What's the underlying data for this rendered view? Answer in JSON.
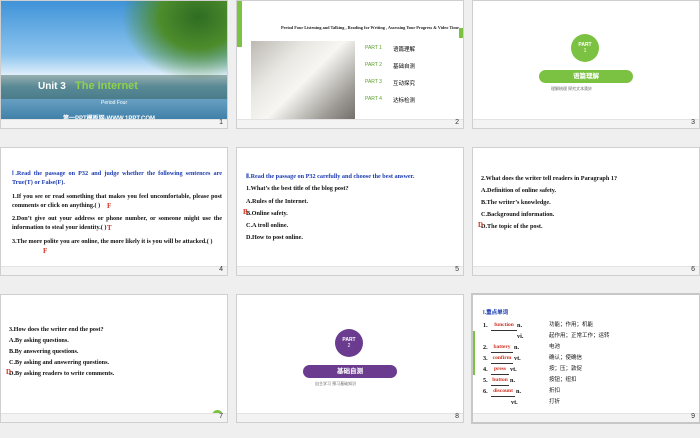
{
  "slides": [
    {
      "num": "1",
      "unit": "Unit 3",
      "title": "The Internet",
      "subtitle": "Period Four",
      "site": "第一PPT模板网-WWW.1PPT.COM"
    },
    {
      "num": "2",
      "header": "Period Four Listening and Talking , Reading for Writing , Assessing Your Progress & Video Time",
      "parts": [
        {
          "label": "PART 1",
          "text": "语篇理解"
        },
        {
          "label": "PART 2",
          "text": "基础自测"
        },
        {
          "label": "PART 3",
          "text": "互动探究"
        },
        {
          "label": "PART 4",
          "text": "达标检测"
        }
      ]
    },
    {
      "num": "3",
      "badge_top": "PART",
      "badge_num": "1",
      "banner": "语篇理解",
      "caption": "理解梳理 探究文本奥妙"
    },
    {
      "num": "4",
      "heading": "Ⅰ.Read the passage on P32 and judge whether the following sentences are True(T) or False(F).",
      "items": [
        "1.If you see or read something that makes you feel uncomfortable, please post comments or click on anything.( )",
        "2.Don’t give out your address or phone number, or someone might use the information to steal your identity.( )",
        "3.The more polite you are online, the more likely it is you will be attacked.( )"
      ],
      "answers": [
        "F",
        "T",
        "F"
      ]
    },
    {
      "num": "5",
      "heading": "Ⅱ.Read the passage on P32 carefully and choose the best answer.",
      "question": "1.What’s the best title of the blog post?",
      "options": [
        "A.Rules of the Internet.",
        "B.Online safety.",
        "C.A troll online.",
        "D.How to post online."
      ],
      "answer": "B"
    },
    {
      "num": "6",
      "question": "2.What does the writer tell readers in Paragraph 1?",
      "options": [
        "A.Definition of online safety.",
        "B.The writer’s knowledge.",
        "C.Background information.",
        "D.The topic of the post."
      ],
      "answer": "D"
    },
    {
      "num": "7",
      "question": "3.How does the writer end the post?",
      "options": [
        "A.By asking questions.",
        "B.By answering questions.",
        "C.By asking and answering questions.",
        "D.By asking readers to write comments."
      ],
      "answer": "D",
      "home_icon": "home-icon"
    },
    {
      "num": "8",
      "badge_top": "PART",
      "badge_num": "2",
      "banner": "基础自测",
      "caption": "自主学习 预习基础知识"
    },
    {
      "num": "9",
      "heading": "Ⅰ.重点单词",
      "words": [
        {
          "n": "1.",
          "w": "function",
          "pos": "n.",
          "meaning": "功能；作用；机能"
        },
        {
          "n": "",
          "w": "",
          "pos": "vi.",
          "meaning": "起作用；正常工作；运转"
        },
        {
          "n": "2.",
          "w": "battery",
          "pos": "n.",
          "meaning": "电池"
        },
        {
          "n": "3.",
          "w": "confirm",
          "pos": "vt.",
          "meaning": "确认；使确信"
        },
        {
          "n": "4.",
          "w": "press",
          "pos": "vt.",
          "meaning": "按；压；敦促"
        },
        {
          "n": "5.",
          "w": "button",
          "pos": "n.",
          "meaning": "按钮；纽扣"
        },
        {
          "n": "6.",
          "w": "discount",
          "pos": "n.",
          "meaning": "折扣"
        },
        {
          "n": "",
          "w": "",
          "pos": "vt.",
          "meaning": "打折"
        }
      ]
    }
  ],
  "colors": {
    "green": "#7cc242",
    "purple": "#6a3b8f",
    "blue": "#1a3ab0",
    "red": "#d0301f"
  }
}
